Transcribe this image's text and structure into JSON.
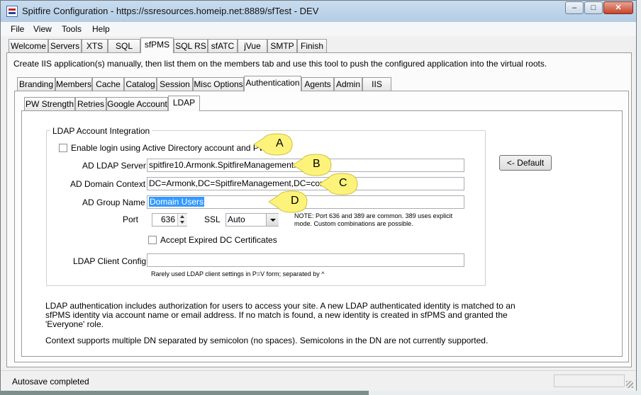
{
  "window": {
    "title": "Spitfire Configuration - https://ssresources.homeip.net:8889/sfTest - DEV",
    "minimize": "–",
    "maximize": "□",
    "close": "✕"
  },
  "menu": [
    "File",
    "View",
    "Tools",
    "Help"
  ],
  "main_tabs": [
    "Welcome",
    "Servers",
    "XTS",
    "SQL",
    "sfPMS",
    "SQL RS",
    "sfATC",
    "jVue",
    "SMTP",
    "Finish"
  ],
  "main_active_tab": "sfPMS",
  "instructions": "Create IIS application(s) manually, then list them on the members tab and use this tool to push the configured application into the virtual roots.",
  "sub_tabs": [
    "Branding",
    "Members",
    "Cache",
    "Catalog",
    "Session",
    "Misc Options",
    "Authentication",
    "Agents",
    "Admin",
    "IIS"
  ],
  "sub_active_tab": "Authentication",
  "auth_tabs": [
    "PW Strength",
    "Retries",
    "Google Account",
    "LDAP"
  ],
  "auth_active_tab": "LDAP",
  "ldap": {
    "group_title": "LDAP Account Integration",
    "enable_label": "Enable login using Active Directory account and PW",
    "enable_checked": false,
    "server_label": "AD LDAP Server",
    "server_value": "spitfire10.Armonk.SpitfireManagement.com",
    "context_label": "AD Domain Context",
    "context_value": "DC=Armonk,DC=SpitfireManagement,DC=com",
    "group_label": "AD Group Name",
    "group_value": "Domain Users",
    "port_label": "Port",
    "port_value": "636",
    "ssl_label": "SSL",
    "ssl_value": "Auto",
    "port_note_1": "NOTE: Port 636 and 389 are common.  389 uses explicit",
    "port_note_2": "mode.  Custom combinations are possible.",
    "expired_label": "Accept Expired DC Certificates",
    "expired_checked": false,
    "client_config_label": "LDAP Client Config",
    "client_config_value": "",
    "client_config_hint": "Rarely used LDAP client settings in P=V form; separated by ^"
  },
  "default_button": "<- Default",
  "callouts": [
    "A",
    "B",
    "C",
    "D"
  ],
  "description": {
    "line1": "LDAP authentication includes authorization for users to access  your site.  A new LDAP authenticated identity is matched to an",
    "line2": "sfPMS identity via account name or email address.  If no match is found, a new identity is created in sfPMS and granted the",
    "line3": "'Everyone' role.",
    "line4": "Context supports multiple DN separated by semicolon (no spaces).  Semicolons in the DN are not currently supported."
  },
  "status": "Autosave completed"
}
